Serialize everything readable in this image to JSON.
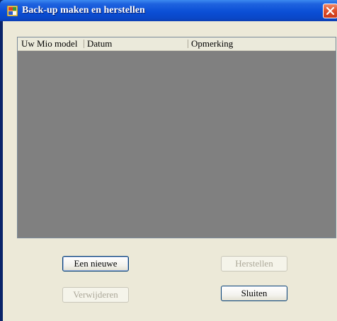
{
  "window": {
    "title": "Back-up maken en herstellen"
  },
  "list": {
    "columns": [
      "Uw Mio model",
      "Datum",
      "Opmerking"
    ],
    "rows": []
  },
  "buttons": {
    "new_label": "Een nieuwe",
    "restore_label": "Herstellen",
    "delete_label": "Verwijderen",
    "close_label": "Sluiten"
  },
  "colors": {
    "titlebar": "#0b4fd6",
    "client_background": "#ece9d8",
    "list_background": "#808080",
    "close_button": "#e0532e"
  },
  "icons": {
    "app": "backup-app-icon",
    "close": "close-icon"
  }
}
